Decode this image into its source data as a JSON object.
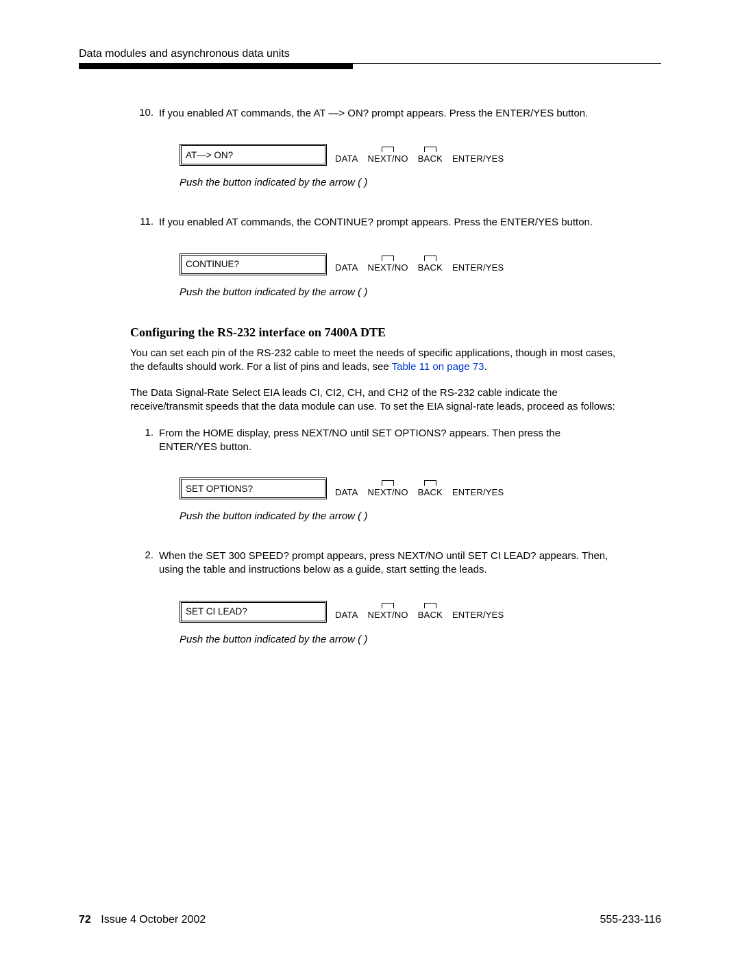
{
  "header": {
    "title": "Data modules and asynchronous data units"
  },
  "displayButtons": {
    "data": "DATA",
    "nextno": "NEXT/NO",
    "back": "BACK",
    "enteryes": "ENTER/YES"
  },
  "steps": {
    "s10": {
      "num": "10.",
      "paraA": "If you enabled AT commands, the AT ",
      "paraB": "> ON? prompt appears. Press the ENTER/YES button.",
      "lcdA": "AT ",
      "lcdB": " > ON?"
    },
    "s11": {
      "num": "11.",
      "para": "If you enabled AT commands, the CONTINUE? prompt appears. Press the ENTER/YES button.",
      "lcd": "CONTINUE?"
    },
    "s1": {
      "num": "1.",
      "para": "From the HOME display, press NEXT/NO until SET OPTIONS? appears. Then press the ENTER/YES button.",
      "lcd": "SET OPTIONS?"
    },
    "s2": {
      "num": "2.",
      "para": "When the SET 300 SPEED?  prompt appears, press NEXT/NO until SET CI LEAD?  appears. Then, using the table and instructions below as a guide, start setting the leads.",
      "lcd": "SET CI LEAD?"
    }
  },
  "caption": "Push the button indicated by the arrow (    )",
  "section": {
    "heading": "Configuring the RS-232 interface on 7400A DTE",
    "p1a": "You can set each pin of the RS-232 cable to meet the needs of specific applications, though in most cases, the defaults should work. For a list of pins and leads, see ",
    "p1link": "Table 11 on page 73",
    "p1b": ".",
    "p2": "The Data Signal-Rate Select EIA leads   CI, CI2, CH, and CH2   of the RS-232 cable indicate the receive/transmit speeds that the data module can use. To set the EIA signal-rate leads, proceed as follows:"
  },
  "footer": {
    "pageNum": "72",
    "issue": "Issue 4   October 2002",
    "docnum": "555-233-116"
  }
}
